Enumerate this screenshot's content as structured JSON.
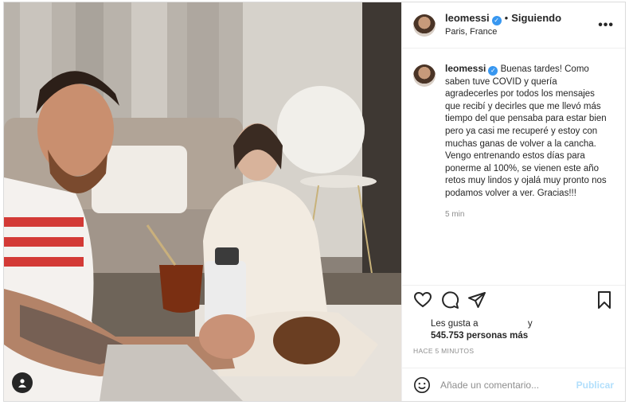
{
  "header": {
    "username": "leomessi",
    "follow_status": "Siguiendo",
    "separator": "•",
    "location": "Paris, France",
    "more_glyph": "•••"
  },
  "caption": {
    "username": "leomessi",
    "text": "Buenas tardes! Como saben tuve COVID y quería agradecerles por todos los mensajes que recibí y decirles que me llevó más tiempo del que pensaba para estar bien pero ya casi me recuperé y estoy con muchas ganas de volver a la cancha. Vengo entrenando estos días para ponerme al 100%, se vienen este año retos muy lindos y ojalá muy pronto nos podamos volver a ver. Gracias!!!",
    "time": "5 min"
  },
  "likes": {
    "prefix": "Les gusta a",
    "conjunction": "y",
    "count_text": "545.753 personas más"
  },
  "timestamp": "HACE 5 MINUTOS",
  "comment": {
    "placeholder": "Añade un comentario...",
    "publish_label": "Publicar"
  },
  "icons": {
    "verified": "verified-badge-icon",
    "like": "heart-icon",
    "comment": "comment-bubble-icon",
    "share": "paper-plane-icon",
    "save": "bookmark-icon",
    "emoji": "emoji-icon",
    "tag": "user-tag-icon"
  },
  "colors": {
    "verified_blue": "#3897f0",
    "publish_disabled": "#b2dffc",
    "secondary_text": "#8e8e8e"
  }
}
